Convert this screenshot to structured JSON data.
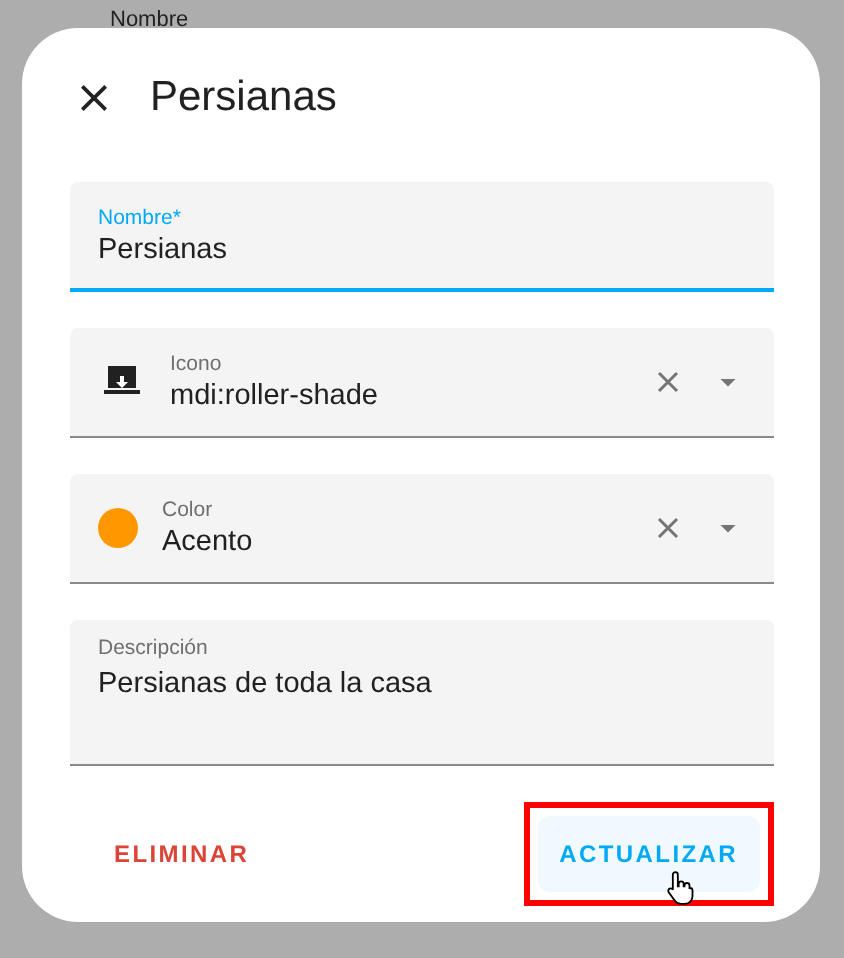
{
  "background": {
    "field_label": "Nombre"
  },
  "dialog": {
    "title": "Persianas",
    "fields": [
      {
        "kind": "text",
        "label": "Nombre*",
        "value": "Persianas",
        "focused": true
      },
      {
        "kind": "icon-select",
        "label": "Icono",
        "value": "mdi:roller-shade",
        "focused": false
      },
      {
        "kind": "color-select",
        "label": "Color",
        "value": "Acento",
        "color": "#ff9800",
        "focused": false
      },
      {
        "kind": "textarea",
        "label": "Descripción",
        "value": "Persianas de toda la casa",
        "focused": false
      }
    ],
    "buttons": [
      {
        "kind": "destructive",
        "label": "ELIMINAR",
        "highlighted": false,
        "hovered": false
      },
      {
        "kind": "primary",
        "label": "ACTUALIZAR",
        "highlighted": true,
        "hovered": true
      }
    ]
  }
}
